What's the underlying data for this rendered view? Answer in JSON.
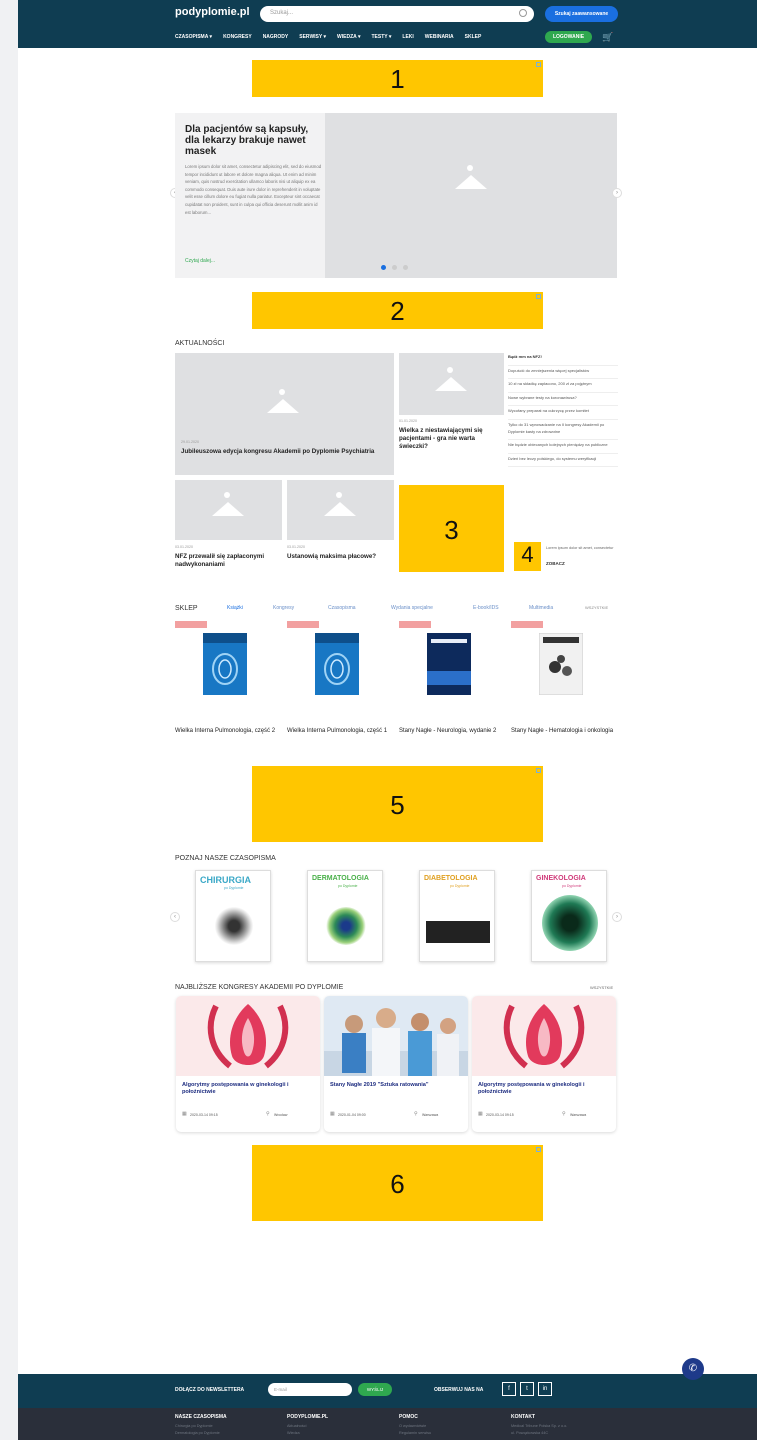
{
  "header": {
    "logo": "podyplomie.pl",
    "search_placeholder": "Szukaj...",
    "advanced_search": "Szukaj zaawansowane",
    "nav": [
      "CZASOPISMA ▾",
      "KONGRESY",
      "NAGRODY",
      "SERWISY ▾",
      "WIEDZA ▾",
      "TESTY ▾",
      "LEKI",
      "WEBINARIA",
      "SKLEP"
    ],
    "login": "LOGOWANIE"
  },
  "ads": [
    "1",
    "2",
    "3",
    "4",
    "5",
    "6"
  ],
  "slider": {
    "title": "Dla pacjentów są kapsuły, dla lekarzy brakuje nawet masek",
    "body": "Lorem ipsum dolor sit amet, consectetur adipiscing elit, sed do eiusmod tempor incididunt ut labore et dolore magna aliqua. Ut enim ad minim veniam, quis nostrud exercitation ullamco laboris nisi ut aliquip ex ea commodo consequat. Duis aute irure dolor in reprehenderit in voluptate velit esse cillum dolore eu fugiat nulla pariatur. Excepteur sint occaecat cupidatat non proident, sunt in culpa qui officia deserunt mollit anim id est laborum...",
    "more": "Czytaj dalej..."
  },
  "news": {
    "title": "AKTUALNOŚCI",
    "main": {
      "date": "29.01.2020",
      "title": "Jubileuszowa edycja kongresu Akademii po Dyplomie Psychiatria"
    },
    "side": {
      "date": "01.01.2020",
      "title": "Wielka z niestawiającymi się pacjentami - gra nie warta świeczki?"
    },
    "small1": {
      "date": "03.01.2020",
      "title": "NFZ przewalił się zapłaconymi nadwykonaniami"
    },
    "small2": {
      "date": "03.01.2020",
      "title": "Ustanowią maksima płacowe?"
    },
    "list": [
      "Bądź mm na NFZ!",
      "Dopuścić do zmniejszenia więcej specjalistów",
      "10 zł na składkę zapłacono, 200 zł za pojętnym",
      "Nowe wybrane testy na koronawirusa?",
      "Wycofany preparat na cukrzycę przez komitet",
      "Tylko do 31 wprowadzanie na II kongresy Akademii po Dyplomie kasty na zdrowotne",
      "Nie będzie obiecanych kolejnych pieniędzy na publiczne",
      "Dzień bez leczy polskiego, do systemu weryfikacji"
    ],
    "promo": {
      "text": "Lorem ipsum dolor sit amet, consectetur",
      "cta": "ZOBACZ"
    }
  },
  "shop": {
    "title": "SKLEP",
    "tabs": [
      "Książki",
      "Kongresy",
      "Czasopisma",
      "Wydania specjalne",
      "E-book/IDS",
      "Multimedia",
      "WSZYSTKIE"
    ],
    "products": [
      "Wielka Interna Pulmonologia, część 2",
      "Wielka Interna Pulmonologia, część 1",
      "Stany Nagłe - Neurologia, wydanie 2",
      "Stany Nagłe - Hematologia i onkologia"
    ]
  },
  "journals": {
    "title": "POZNAJ NASZE CZASOPISMA",
    "items": [
      "CHIRURGIA",
      "DERMATOLOGIA",
      "DIABETOLOGIA",
      "GINEKOLOGIA"
    ],
    "subtitle": "po Dyplomie"
  },
  "congresses": {
    "title": "NAJBLIŻSZE KONGRESY AKADEMII PO DYPLOMIE",
    "all": "WSZYSTKIE",
    "items": [
      {
        "title": "Algorytmy postępowania w ginekologii i położnictwie",
        "date": "2020-03-14 09:15",
        "place": "Wrocław"
      },
      {
        "title": "Stany Nagłe 2019 \"Sztuka ratowania\"",
        "date": "2020-01-04 09:00",
        "place": "Warszawa"
      },
      {
        "title": "Algorytmy postępowania w ginekologii i położnictwie",
        "date": "2020-03-14 09:15",
        "place": "Warszawa"
      }
    ]
  },
  "newsletter": {
    "label": "DOŁĄCZ DO NEWSLETTERA",
    "placeholder": "E-mail",
    "send": "WYŚLIJ",
    "follow": "OBSERWUJ NAS NA"
  },
  "footer": {
    "col1": {
      "head": "NASZE CZASOPISMA",
      "items": [
        "Chirurgia po Dyplomie",
        "Dermatologia po Dyplomie",
        "Diabetologia po Dyplomie"
      ]
    },
    "col2": {
      "head": "PODYPLOMIE.PL",
      "items": [
        "Aktualności",
        "Wiedza",
        "Kongresy"
      ]
    },
    "col3": {
      "head": "POMOC",
      "items": [
        "O wydawnictwie",
        "Regulamin serwisu",
        "Polityka prywatności"
      ]
    },
    "col4": {
      "head": "KONTAKT",
      "items": [
        "Medical Tribune Polska Sp. z o.o.",
        "ul. Powązkowska 44C",
        "01-797 Warszawa"
      ]
    }
  },
  "colors": {
    "header": "#0f3d52",
    "ad": "#ffc600",
    "accent": "#1a6fe0",
    "green": "#2fa84f"
  }
}
